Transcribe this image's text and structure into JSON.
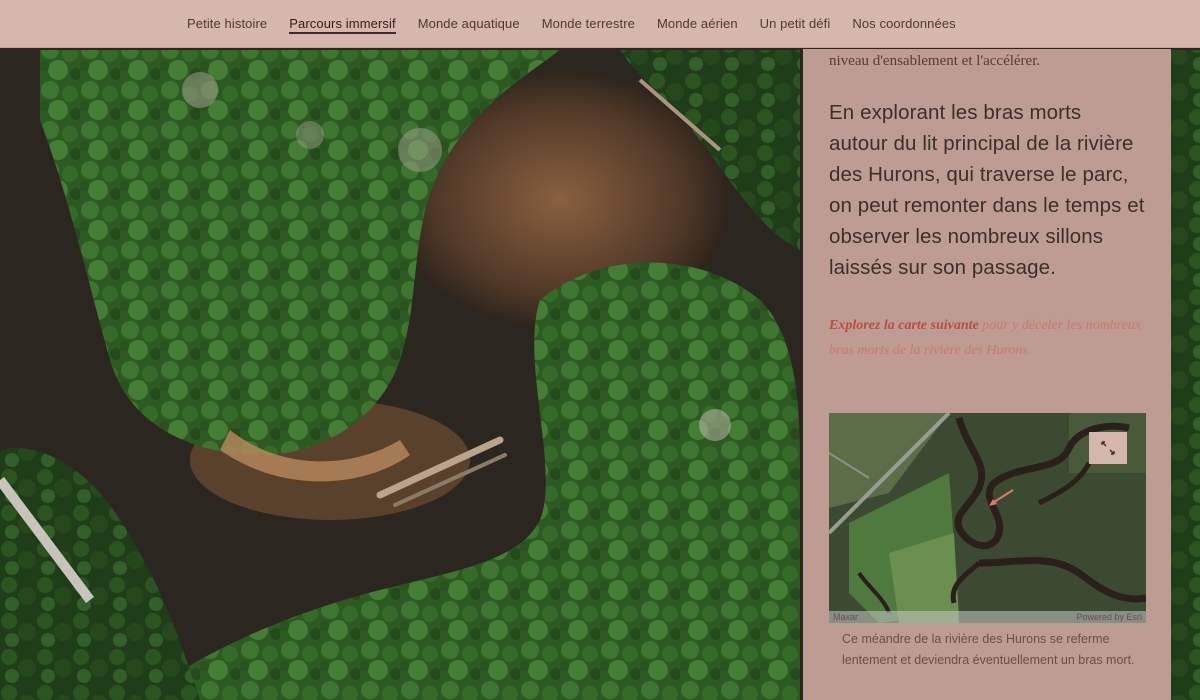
{
  "nav": {
    "items": [
      {
        "label": "Petite histoire",
        "active": false
      },
      {
        "label": "Parcours immersif",
        "active": true
      },
      {
        "label": "Monde aquatique",
        "active": false
      },
      {
        "label": "Monde terrestre",
        "active": false
      },
      {
        "label": "Monde aérien",
        "active": false
      },
      {
        "label": "Un petit défi",
        "active": false
      },
      {
        "label": "Nos coordonnées",
        "active": false
      }
    ]
  },
  "panel": {
    "prev_text": "niveau d'ensablement et l'accélérer.",
    "lead": "En explorant les bras morts autour du lit principal de la rivière des Hurons, qui traverse le parc, on peut remonter dans le temps et observer les nombreux sillons laissés sur son passage.",
    "note_link": "Explorez la carte suivante",
    "note_rest": " pour y déceler les nombreux bras morts de la rivière des Hurons.",
    "map": {
      "attribution_left": "Maxar",
      "attribution_right": "Powered by Esri",
      "expand_icon": "expand-arrows-icon",
      "marker_icon": "arrow-marker-icon"
    },
    "caption": "Ce méandre de la rivière des Hurons se referme lentement et deviendra éventuellement un bras mort."
  },
  "colors": {
    "nav_bg": "#d6b7ad",
    "panel_bg": "#caa69c",
    "accent_link": "#b84d3f",
    "text_dark": "#3c2f2b"
  }
}
